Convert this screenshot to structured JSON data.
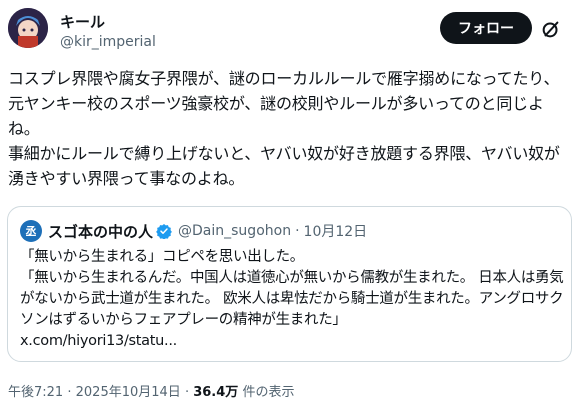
{
  "author": {
    "display_name": "キール",
    "handle": "@kir_imperial"
  },
  "header": {
    "follow_label": "フォロー"
  },
  "tweet": {
    "text": "コスプレ界隈や腐女子界隈が、謎のローカルルールで雁字搦めになってたり、元ヤンキー校のスポーツ強豪校が、謎の校則やルールが多いってのと同じよね。\n事細かにルールで縛り上げないと、ヤバい奴が好き放題する界隈、ヤバい奴が湧きやすい界隈って事なのよね。"
  },
  "quote": {
    "avatar_text": "丞",
    "display_name": "スゴ本の中の人",
    "handle": "@Dain_sugohon",
    "separator": "·",
    "date": "10月12日",
    "text": "「無いから生まれる」コピペを思い出した。\n「無いから生まれるんだ。中国人は道徳心が無いから儒教が生まれた。 日本人は勇気がないから武士道が生まれた。 欧米人は卑怯だから騎士道が生まれた。アングロサクソンはずるいからフェアプレーの精神が生まれた」",
    "link": "x.com/hiyori13/statu..."
  },
  "meta": {
    "time": "午後7:21",
    "separator": "·",
    "date": "2025年10月14日",
    "separator2": "·",
    "views": "36.4万",
    "views_label": "件の表示"
  },
  "colors": {
    "text": "#0f1419",
    "secondary": "#536471",
    "follow_bg": "#0f1419",
    "verified": "#1d9bf0"
  }
}
